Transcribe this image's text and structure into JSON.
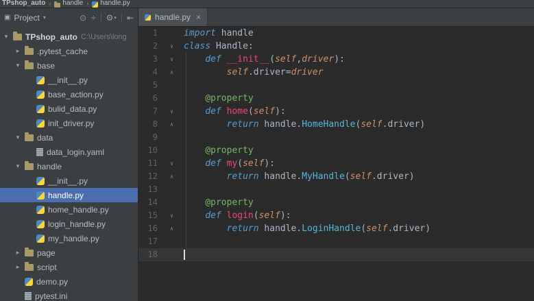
{
  "colors": {
    "panel_bg": "#3c3f41",
    "editor_bg": "#2b2b2b",
    "selection_bg": "#4b6eaf",
    "current_line_bg": "#343638",
    "tab_bg": "#4c5052",
    "text": "#a9b7c6",
    "line_number": "#606366",
    "keyword": "#569cd6",
    "function_name": "#ee4674",
    "decorator": "#77b767",
    "class_ref": "#58b5dc",
    "self_param": "#cf8e6d",
    "folder_icon": "#a89968",
    "python_blue": "#4b8bbe",
    "python_yellow": "#ffd43b",
    "caret": "#dcdcdc"
  },
  "breadcrumb": {
    "separator": "›",
    "items": [
      {
        "label": "TPshop_auto",
        "icon": null
      },
      {
        "label": "handle",
        "icon": "folder"
      },
      {
        "label": "handle.py",
        "icon": "python"
      }
    ]
  },
  "project_panel": {
    "window_icon": "▣",
    "title": "Project",
    "caret": "▾",
    "icons": [
      {
        "name": "locate-file-icon",
        "glyph": "⊙"
      },
      {
        "name": "collapse-all-icon",
        "glyph": "÷"
      },
      {
        "sep": true
      },
      {
        "name": "settings-gear-icon",
        "glyph": "⚙",
        "caret": "▾"
      },
      {
        "sep": true
      },
      {
        "name": "hide-panel-icon",
        "glyph": "⇤"
      }
    ],
    "tree": [
      {
        "type": "root",
        "arrow": "▾",
        "icon": "folder",
        "label": "TPshop_auto",
        "suffix": "C:\\Users\\long",
        "depth": 0
      },
      {
        "arrow": "▸",
        "icon": "folder",
        "label": ".pytest_cache",
        "depth": 1
      },
      {
        "arrow": "▾",
        "icon": "folder",
        "label": "base",
        "depth": 1
      },
      {
        "icon": "python",
        "label": "__init__.py",
        "depth": 2
      },
      {
        "icon": "python",
        "label": "base_action.py",
        "depth": 2
      },
      {
        "icon": "python",
        "label": "bulid_data.py",
        "depth": 2
      },
      {
        "icon": "python",
        "label": "init_driver.py",
        "depth": 2
      },
      {
        "arrow": "▾",
        "icon": "folder",
        "label": "data",
        "depth": 1
      },
      {
        "icon": "yaml",
        "label": "data_login.yaml",
        "depth": 2
      },
      {
        "arrow": "▾",
        "icon": "folder",
        "label": "handle",
        "depth": 1
      },
      {
        "icon": "python",
        "label": "__init__.py",
        "depth": 2
      },
      {
        "icon": "python",
        "label": "handle.py",
        "depth": 2,
        "selected": true
      },
      {
        "icon": "python",
        "label": "home_handle.py",
        "depth": 2
      },
      {
        "icon": "python",
        "label": "login_handle.py",
        "depth": 2
      },
      {
        "icon": "python",
        "label": "my_handle.py",
        "depth": 2
      },
      {
        "arrow": "▸",
        "icon": "folder",
        "label": "page",
        "depth": 1
      },
      {
        "arrow": "▸",
        "icon": "folder",
        "label": "script",
        "depth": 1
      },
      {
        "icon": "python",
        "label": "demo.py",
        "depth": 1
      },
      {
        "icon": "ini",
        "label": "pytest.ini",
        "depth": 1
      }
    ]
  },
  "editor": {
    "tab": {
      "label": "handle.py",
      "close_glyph": "×"
    },
    "current_line": 18,
    "caret": {
      "line": 18,
      "column": 0
    },
    "indent_guide": {
      "from_line": 3,
      "to_line": 17
    },
    "fold_glyphs": {
      "down": "∨",
      "up": "∧"
    },
    "lines": [
      {
        "n": 1,
        "tokens": [
          [
            "kw",
            "import"
          ],
          [
            "pl",
            " handle"
          ]
        ]
      },
      {
        "n": 2,
        "fold": "down",
        "tokens": [
          [
            "kw",
            "class "
          ],
          [
            "pl",
            "Handle:"
          ]
        ]
      },
      {
        "n": 3,
        "fold": "down",
        "tokens": [
          [
            "pl",
            "    "
          ],
          [
            "kw",
            "def "
          ],
          [
            "fn",
            "__init__"
          ],
          [
            "pl",
            "("
          ],
          [
            "self",
            "self"
          ],
          [
            "pl",
            ","
          ],
          [
            "param",
            "driver"
          ],
          [
            "pl",
            "):"
          ]
        ]
      },
      {
        "n": 4,
        "fold": "up",
        "tokens": [
          [
            "pl",
            "        "
          ],
          [
            "self",
            "self"
          ],
          [
            "pl",
            ".driver="
          ],
          [
            "param",
            "driver"
          ]
        ]
      },
      {
        "n": 5,
        "tokens": []
      },
      {
        "n": 6,
        "tokens": [
          [
            "pl",
            "    "
          ],
          [
            "dec",
            "@property"
          ]
        ]
      },
      {
        "n": 7,
        "fold": "down",
        "tokens": [
          [
            "pl",
            "    "
          ],
          [
            "kw",
            "def "
          ],
          [
            "fn",
            "home"
          ],
          [
            "pl",
            "("
          ],
          [
            "self",
            "self"
          ],
          [
            "pl",
            "):"
          ]
        ]
      },
      {
        "n": 8,
        "fold": "up",
        "tokens": [
          [
            "pl",
            "        "
          ],
          [
            "kw",
            "return "
          ],
          [
            "pl",
            "handle."
          ],
          [
            "cls",
            "HomeHandle"
          ],
          [
            "pl",
            "("
          ],
          [
            "self",
            "self"
          ],
          [
            "pl",
            ".driver)"
          ]
        ]
      },
      {
        "n": 9,
        "tokens": []
      },
      {
        "n": 10,
        "tokens": [
          [
            "pl",
            "    "
          ],
          [
            "dec",
            "@property"
          ]
        ]
      },
      {
        "n": 11,
        "fold": "down",
        "tokens": [
          [
            "pl",
            "    "
          ],
          [
            "kw",
            "def "
          ],
          [
            "fn",
            "my"
          ],
          [
            "pl",
            "("
          ],
          [
            "self",
            "self"
          ],
          [
            "pl",
            "):"
          ]
        ]
      },
      {
        "n": 12,
        "fold": "up",
        "tokens": [
          [
            "pl",
            "        "
          ],
          [
            "kw",
            "return "
          ],
          [
            "pl",
            "handle."
          ],
          [
            "cls",
            "MyHandle"
          ],
          [
            "pl",
            "("
          ],
          [
            "self",
            "self"
          ],
          [
            "pl",
            ".driver)"
          ]
        ]
      },
      {
        "n": 13,
        "tokens": []
      },
      {
        "n": 14,
        "tokens": [
          [
            "pl",
            "    "
          ],
          [
            "dec",
            "@property"
          ]
        ]
      },
      {
        "n": 15,
        "fold": "down",
        "tokens": [
          [
            "pl",
            "    "
          ],
          [
            "kw",
            "def "
          ],
          [
            "fn",
            "login"
          ],
          [
            "pl",
            "("
          ],
          [
            "self",
            "self"
          ],
          [
            "pl",
            "):"
          ]
        ]
      },
      {
        "n": 16,
        "fold": "up",
        "tokens": [
          [
            "pl",
            "        "
          ],
          [
            "kw",
            "return "
          ],
          [
            "pl",
            "handle."
          ],
          [
            "cls",
            "LoginHandle"
          ],
          [
            "pl",
            "("
          ],
          [
            "self",
            "self"
          ],
          [
            "pl",
            ".driver)"
          ]
        ]
      },
      {
        "n": 17,
        "tokens": []
      },
      {
        "n": 18,
        "tokens": []
      }
    ]
  }
}
